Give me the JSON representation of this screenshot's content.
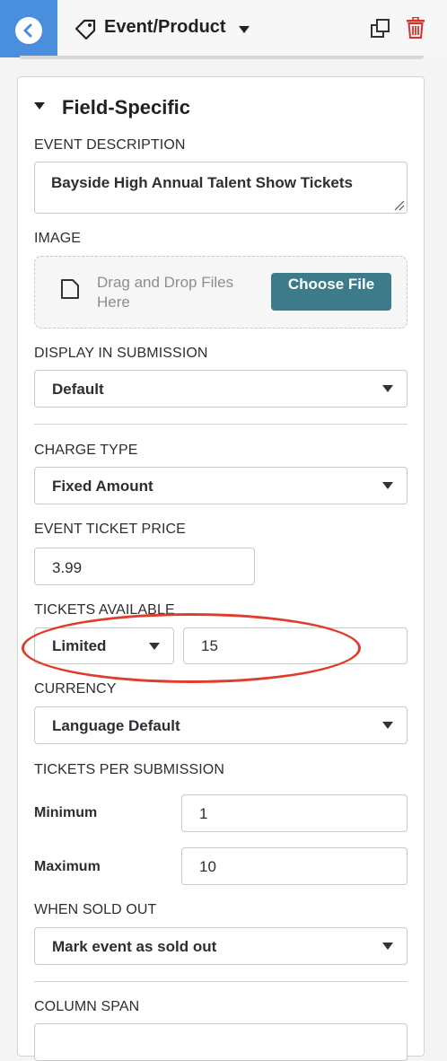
{
  "header": {
    "title": "Event/Product"
  },
  "section": {
    "title": "Field-Specific"
  },
  "event_description": {
    "label": "EVENT DESCRIPTION",
    "value": "Bayside High Annual Talent Show Tickets"
  },
  "image": {
    "label": "IMAGE",
    "drop_text": "Drag and Drop Files Here",
    "button": "Choose File"
  },
  "display_in_submission": {
    "label": "DISPLAY IN SUBMISSION",
    "value": "Default"
  },
  "charge_type": {
    "label": "CHARGE TYPE",
    "value": "Fixed Amount"
  },
  "ticket_price": {
    "label": "EVENT TICKET PRICE",
    "value": "3.99"
  },
  "tickets_available": {
    "label": "TICKETS AVAILABLE",
    "mode": "Limited",
    "quantity": "15"
  },
  "currency": {
    "label": "CURRENCY",
    "value": "Language Default"
  },
  "tickets_per_submission": {
    "label": "TICKETS PER SUBMISSION",
    "min_label": "Minimum",
    "min_value": "1",
    "max_label": "Maximum",
    "max_value": "10"
  },
  "when_sold_out": {
    "label": "WHEN SOLD OUT",
    "value": "Mark event as sold out"
  },
  "column_span": {
    "label": "COLUMN SPAN"
  },
  "colors": {
    "accent_blue": "#4a8fde",
    "button_teal": "#3d7a8a",
    "delete_red": "#d9302c",
    "annotation_red": "#e03c2b"
  },
  "icons": [
    "back-arrow-icon",
    "tag-icon",
    "chevron-down-icon",
    "duplicate-icon",
    "trash-icon",
    "caret-down-icon",
    "file-icon",
    "resize-handle-icon"
  ]
}
